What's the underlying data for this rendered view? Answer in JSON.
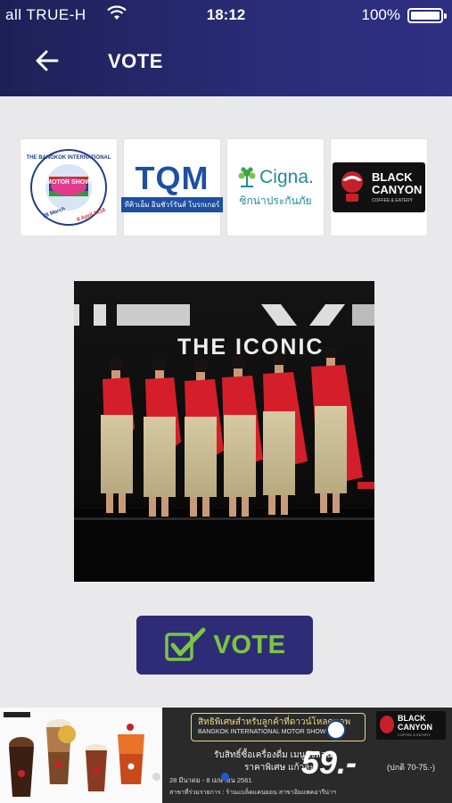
{
  "status_bar": {
    "carrier": "all TRUE-H",
    "time": "18:12",
    "battery": "100%"
  },
  "nav": {
    "title": "VOTE",
    "back_icon": "arrow-left-icon"
  },
  "sponsors": [
    {
      "name": "Bangkok International Motor Show",
      "logo_text_top": "THE BANGKOK INTERNATIONAL",
      "logo_text_mid": "MOTOR SHOW",
      "logo_text_left": "28 March",
      "logo_text_right": "8 April 2018"
    },
    {
      "name": "TQM",
      "logo_text": "TQM",
      "logo_sub": "ทีคิวเอ็ม อินชัวร์รันส์ โบรกเกอร์"
    },
    {
      "name": "Cigna",
      "logo_text": "Cigna.",
      "logo_sub": "ซิกน่าประกันภัย"
    },
    {
      "name": "Black Canyon",
      "logo_text_1": "BLACK",
      "logo_text_2": "CANYON",
      "logo_sub": "COFFEE & EATERY"
    }
  ],
  "photo": {
    "stage_text": "THE ICONIC"
  },
  "vote_button": {
    "label": "VOTE",
    "icon": "checkbox-check-icon"
  },
  "banner": {
    "headline": "สิทธิพิเศษสำหรับลูกค้าที่ดาวน์โหลดแอพ",
    "subhead": "BANGKOK INTERNATIONAL MOTOR SHOW",
    "offer_1": "รับสิทธิ์ซื้อเครื่องดื่ม เมนูดังลอน",
    "offer_2": "ราคาพิเศษ แก้วละ",
    "price": "59.-",
    "price_note": "(ปกติ 70-75.-)",
    "dates": "28 มีนาคม - 8 เมษายน 2561",
    "branch": "สาขาที่ร่วมรายการ : ร้านแบล็คแคนยอน สาขาอิมแพคอารีน่าฯ",
    "brand_1": "BLACK",
    "brand_2": "CANYON",
    "brand_sub": "COFFEE & EATERY",
    "accent": "#f0d585"
  },
  "colors": {
    "header": "#2a2c78",
    "vote_bg": "#2e2c77",
    "vote_text": "#7cc544",
    "page_bg": "#e9e9ec"
  }
}
